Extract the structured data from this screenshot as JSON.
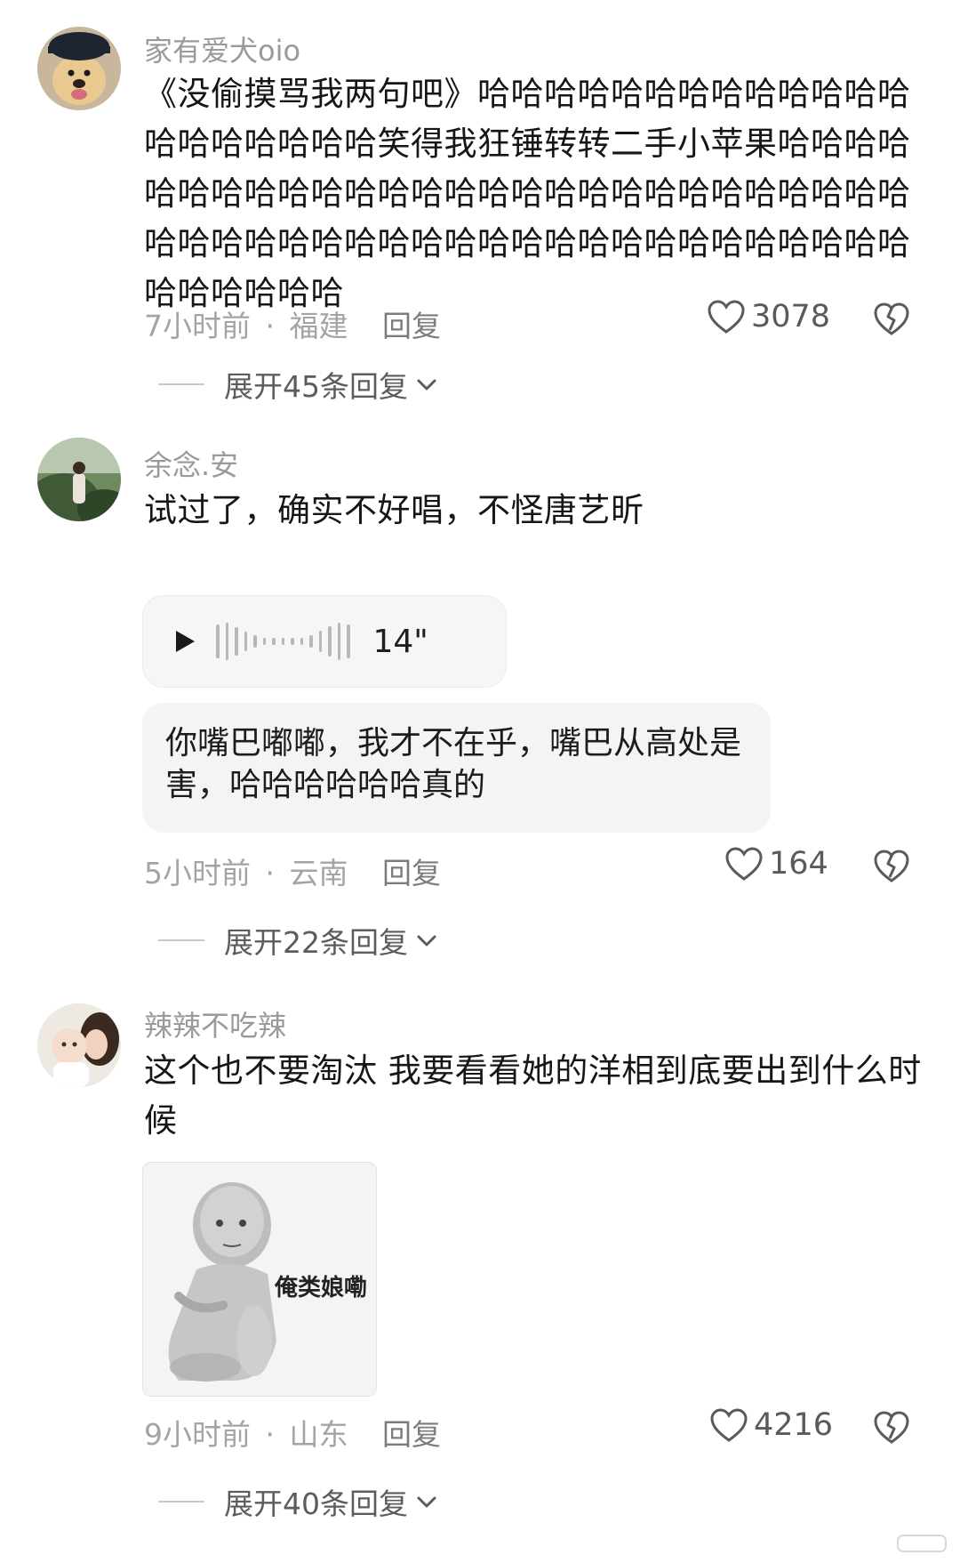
{
  "comments": [
    {
      "username": "家有爱犬oio",
      "text": "《没偷摸骂我两句吧》哈哈哈哈哈哈哈哈哈哈哈哈哈哈哈哈哈哈哈哈笑得我狂锤转转二手小苹果哈哈哈哈哈哈哈哈哈哈哈哈哈哈哈哈哈哈哈哈哈哈哈哈哈哈哈哈哈哈哈哈哈哈哈哈哈哈哈哈哈哈哈哈哈哈哈哈哈哈哈哈哈哈哈哈",
      "time": "7小时前",
      "location": "福建",
      "reply_label": "回复",
      "likes": "3078",
      "expand_label": "展开45条回复"
    },
    {
      "username": "余念.安",
      "text": "试过了，确实不好唱，不怪唐艺昕",
      "voice_duration": "14\"",
      "transcript": "你嘴巴嘟嘟，我才不在乎，嘴巴从高处是害，哈哈哈哈哈哈真的",
      "time": "5小时前",
      "location": "云南",
      "reply_label": "回复",
      "likes": "164",
      "expand_label": "展开22条回复"
    },
    {
      "username": "辣辣不吃辣",
      "text": "这个也不要淘汰 我要看看她的洋相到底要出到什么时候",
      "sticker_text": "俺类娘嘞",
      "time": "9小时前",
      "location": "山东",
      "reply_label": "回复",
      "likes": "4216",
      "expand_label": "展开40条回复"
    }
  ],
  "meta_separator": "·",
  "icons": {
    "like": "heart-outline-icon",
    "dislike": "broken-heart-icon",
    "expand": "chevron-down-icon",
    "play": "play-icon"
  },
  "colors": {
    "username": "#9a9a9a",
    "meta": "#a4a4a4",
    "bubble_bg": "#f4f4f5"
  }
}
